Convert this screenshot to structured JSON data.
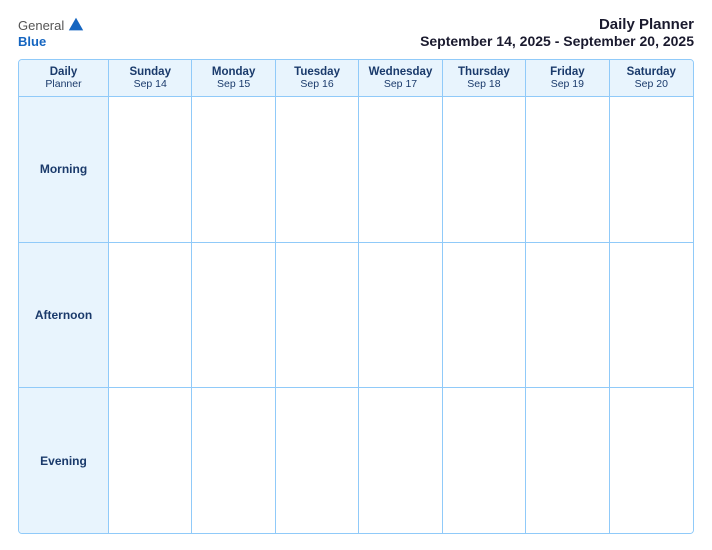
{
  "header": {
    "logo_general": "General",
    "logo_blue": "Blue",
    "title": "Daily Planner",
    "date_range": "September 14, 2025 - September 20, 2025"
  },
  "calendar": {
    "label_cell": {
      "line1": "Daily",
      "line2": "Planner"
    },
    "columns": [
      {
        "day": "Sunday",
        "date": "Sep 14"
      },
      {
        "day": "Monday",
        "date": "Sep 15"
      },
      {
        "day": "Tuesday",
        "date": "Sep 16"
      },
      {
        "day": "Wednesday",
        "date": "Sep 17"
      },
      {
        "day": "Thursday",
        "date": "Sep 18"
      },
      {
        "day": "Friday",
        "date": "Sep 19"
      },
      {
        "day": "Saturday",
        "date": "Sep 20"
      }
    ],
    "rows": [
      {
        "label": "Morning"
      },
      {
        "label": "Afternoon"
      },
      {
        "label": "Evening"
      }
    ]
  }
}
